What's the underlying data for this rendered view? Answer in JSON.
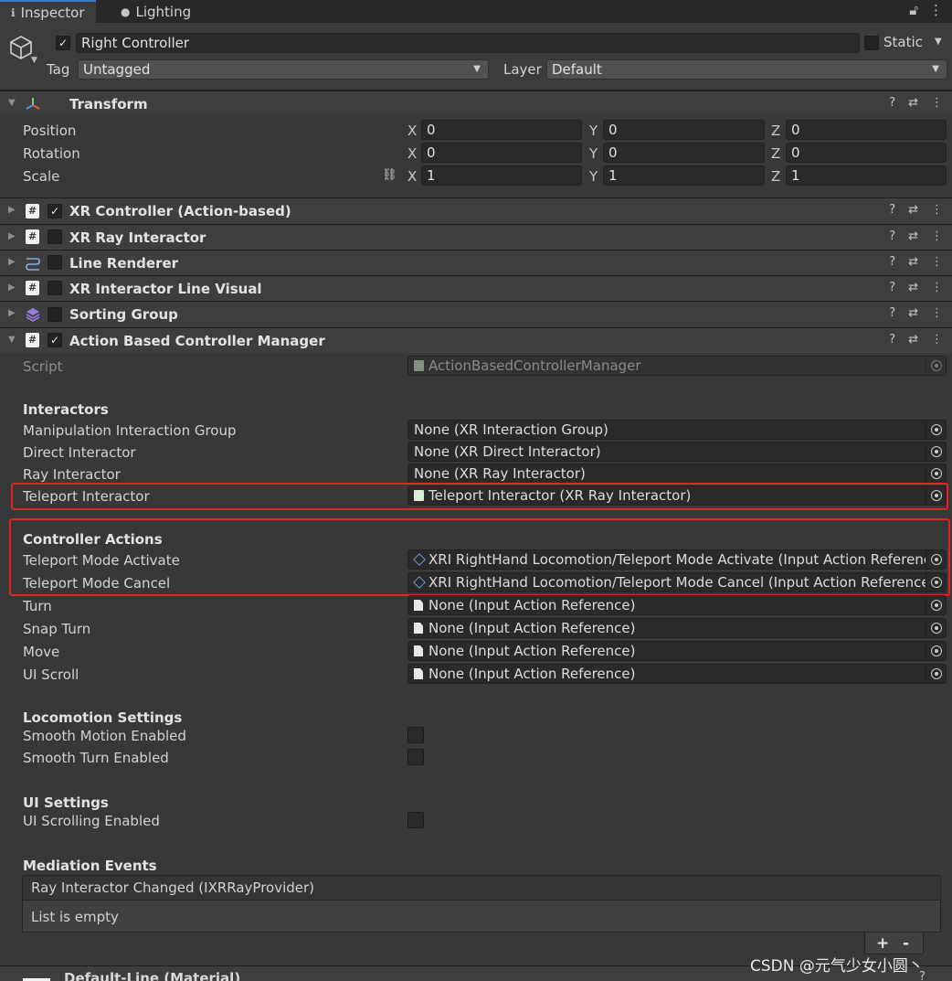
{
  "tabs": [
    {
      "label": "Inspector"
    },
    {
      "label": "Lighting"
    }
  ],
  "header": {
    "object_name": "Right Controller",
    "static_label": "Static",
    "tag_label": "Tag",
    "tag_value": "Untagged",
    "layer_label": "Layer",
    "layer_value": "Default"
  },
  "transform": {
    "title": "Transform",
    "rows": [
      {
        "label": "Position",
        "x": "0",
        "y": "0",
        "z": "0"
      },
      {
        "label": "Rotation",
        "x": "0",
        "y": "0",
        "z": "0"
      },
      {
        "label": "Scale",
        "x": "1",
        "y": "1",
        "z": "1"
      }
    ],
    "axis_x": "X",
    "axis_y": "Y",
    "axis_z": "Z"
  },
  "components": [
    {
      "title": "XR Controller (Action-based)",
      "enabled": true
    },
    {
      "title": "XR Ray Interactor",
      "enabled": false
    },
    {
      "title": "Line Renderer",
      "enabled": false
    },
    {
      "title": "XR Interactor Line Visual",
      "enabled": false
    },
    {
      "title": "Sorting Group",
      "enabled": false
    },
    {
      "title": "Action Based Controller Manager",
      "enabled": true
    }
  ],
  "manager": {
    "script_label": "Script",
    "script_value": "ActionBasedControllerManager",
    "interactors_header": "Interactors",
    "interactors": [
      {
        "label": "Manipulation Interaction Group",
        "value": "None (XR Interaction Group)"
      },
      {
        "label": "Direct Interactor",
        "value": "None (XR Direct Interactor)"
      },
      {
        "label": "Ray Interactor",
        "value": "None (XR Ray Interactor)"
      },
      {
        "label": "Teleport Interactor",
        "value": "Teleport Interactor (XR Ray Interactor)"
      }
    ],
    "actions_header": "Controller Actions",
    "actions": [
      {
        "label": "Teleport Mode Activate",
        "value": "XRI RightHand Locomotion/Teleport Mode Activate (Input Action Reference)"
      },
      {
        "label": "Teleport Mode Cancel",
        "value": "XRI RightHand Locomotion/Teleport Mode Cancel (Input Action Reference)"
      },
      {
        "label": "Turn",
        "value": "None (Input Action Reference)"
      },
      {
        "label": "Snap Turn",
        "value": "None (Input Action Reference)"
      },
      {
        "label": "Move",
        "value": "None (Input Action Reference)"
      },
      {
        "label": "UI Scroll",
        "value": "None (Input Action Reference)"
      }
    ],
    "locomotion_header": "Locomotion Settings",
    "locomotion": [
      {
        "label": "Smooth Motion Enabled"
      },
      {
        "label": "Smooth Turn Enabled"
      }
    ],
    "ui_header": "UI Settings",
    "ui": [
      {
        "label": "UI Scrolling Enabled"
      }
    ],
    "mediation_header": "Mediation Events",
    "event_title": "Ray Interactor Changed (IXRRayProvider)",
    "event_empty": "List is empty",
    "add_label": "+",
    "remove_label": "-"
  },
  "footer": {
    "material": "Default-Line (Material)",
    "watermark": "CSDN @元气少女小圆丶"
  },
  "colors": {
    "highlight": "#e0241f",
    "accent": "#3a79bb"
  }
}
